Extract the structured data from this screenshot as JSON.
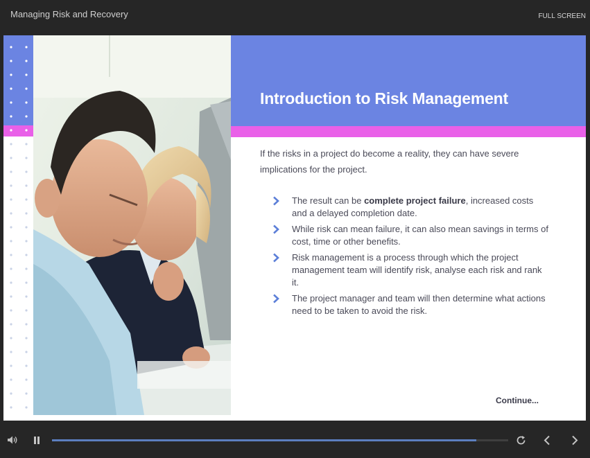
{
  "header": {
    "title": "Managing Risk and Recovery",
    "fullscreen_label": "FULL SCREEN"
  },
  "slide": {
    "title": "Introduction to Risk Management",
    "intro": "If the risks in a project do become a reality, they can have severe implications for the project.",
    "bullets": [
      {
        "before": "The result can be ",
        "bold": "complete project failure",
        "after": ", increased costs and a delayed completion date."
      },
      {
        "text": "While risk can mean failure, it can also mean savings in terms of cost, time or other benefits."
      },
      {
        "text": "Risk management is a process through which the project management team will identify risk, analyse each risk and rank it."
      },
      {
        "text": "The project manager and team will then determine what actions need to be taken to avoid the risk."
      }
    ],
    "continue_label": "Continue...",
    "photo_icon": "business-people-photo"
  },
  "player": {
    "progress_fraction": 0.93,
    "icons": {
      "volume": "volume-icon",
      "pause": "pause-icon",
      "replay": "replay-icon",
      "previous": "chevron-left-icon",
      "next": "chevron-right-icon"
    }
  },
  "colors": {
    "header_band": "#6b84e2",
    "accent_pink": "#e960e8",
    "chevron": "#5c7fd8",
    "progress": "#5c7fc0",
    "background": "#262626"
  }
}
